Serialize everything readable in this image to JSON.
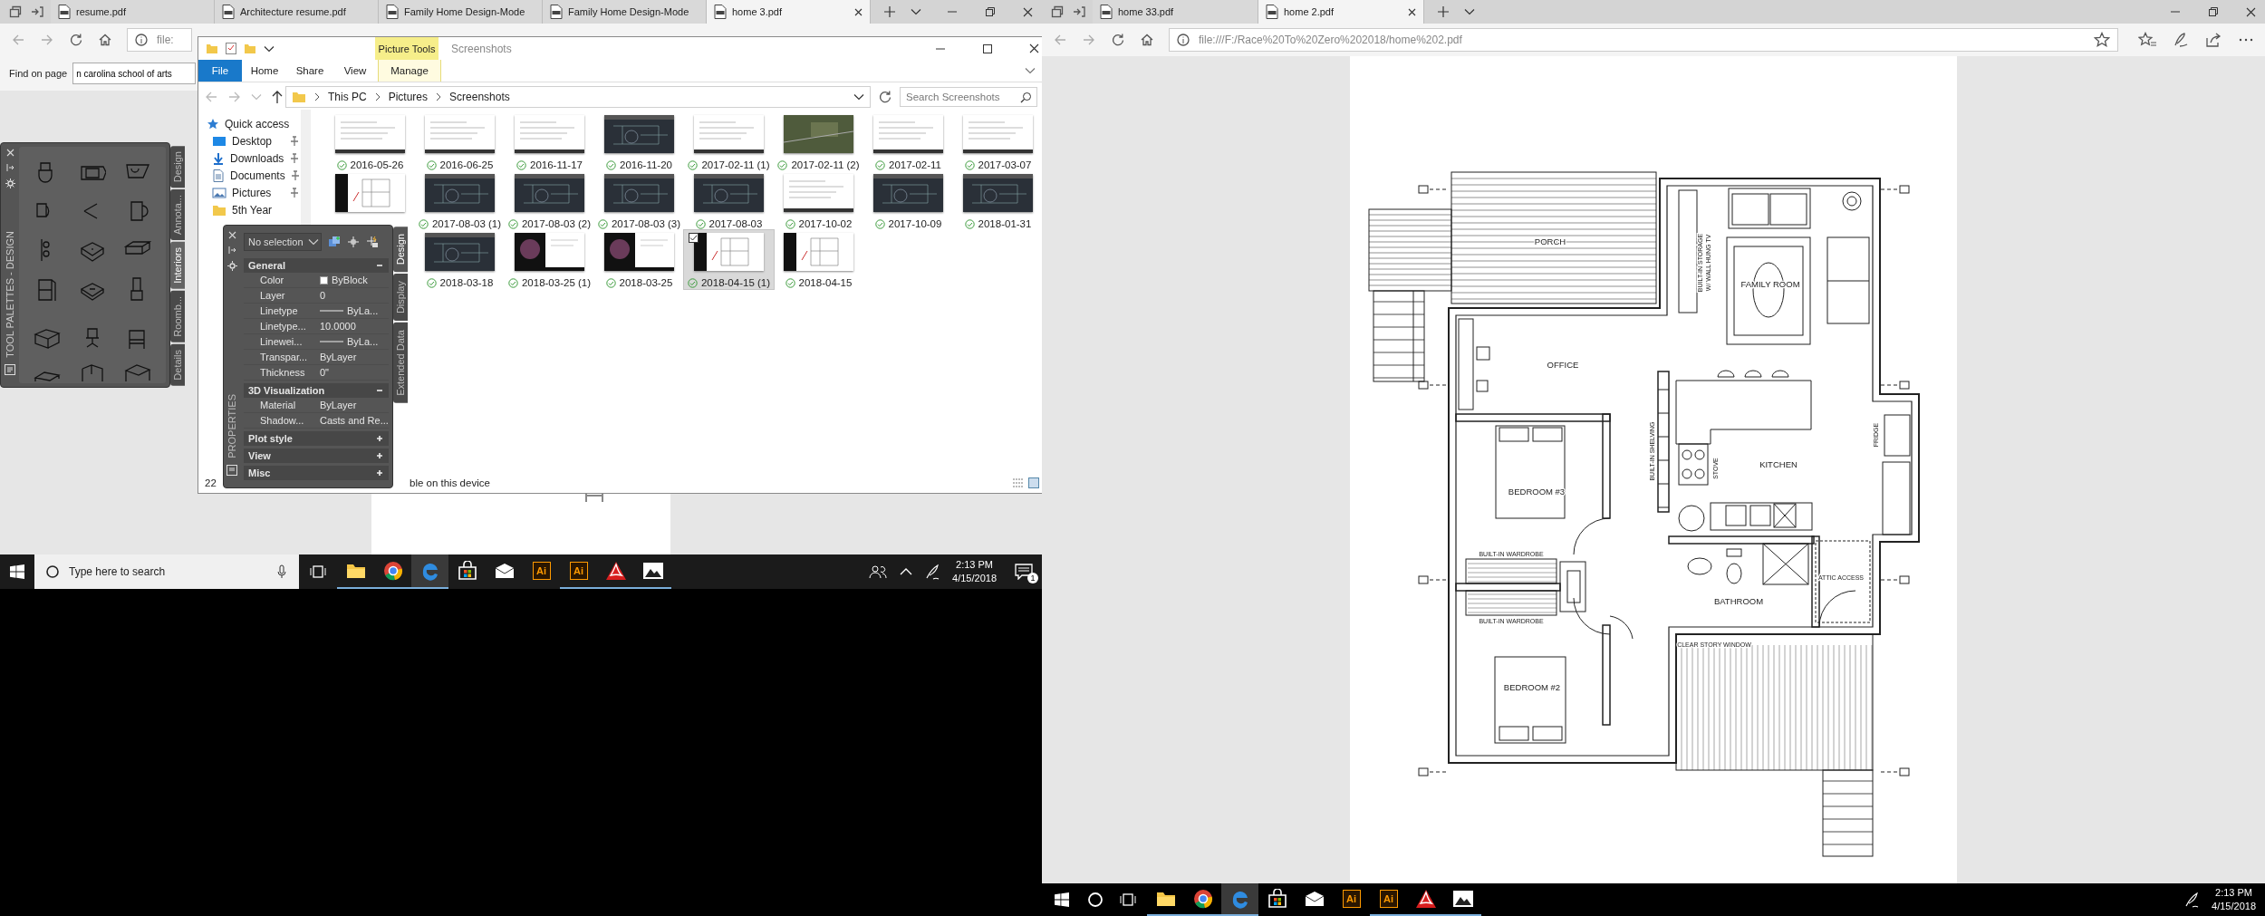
{
  "left_browser": {
    "tabs": [
      {
        "title": "resume.pdf",
        "selected": false
      },
      {
        "title": "Architecture resume.pdf",
        "selected": false
      },
      {
        "title": "Family Home Design-Mode",
        "selected": false
      },
      {
        "title": "Family Home Design-Mode",
        "selected": false
      },
      {
        "title": "home 3.pdf",
        "selected": true
      }
    ],
    "address": "file:",
    "find_bar": {
      "label": "Find on page",
      "value": "n carolina school of arts"
    }
  },
  "file_explorer": {
    "title": "Screenshots",
    "context_tab": "Picture Tools",
    "ribbon_tabs": [
      {
        "label": "File",
        "kind": "file",
        "selected": false
      },
      {
        "label": "Home",
        "kind": "tab",
        "selected": false
      },
      {
        "label": "Share",
        "kind": "tab",
        "selected": false
      },
      {
        "label": "View",
        "kind": "tab",
        "selected": false
      },
      {
        "label": "Manage",
        "kind": "context",
        "selected": false
      }
    ],
    "breadcrumb": [
      "This PC",
      "Pictures",
      "Screenshots"
    ],
    "search": {
      "placeholder": "Search Screenshots"
    },
    "nav_items": [
      {
        "label": "Quick access",
        "kind": "star",
        "pinned": false
      },
      {
        "label": "Desktop",
        "kind": "desktop",
        "pinned": true
      },
      {
        "label": "Downloads",
        "kind": "download",
        "pinned": true
      },
      {
        "label": "Documents",
        "kind": "document",
        "pinned": true
      },
      {
        "label": "Pictures",
        "kind": "picture",
        "pinned": true
      },
      {
        "label": "5th Year",
        "kind": "folder",
        "pinned": false
      }
    ],
    "files": [
      {
        "name": "2016-05-26",
        "kind": "light",
        "selected": false
      },
      {
        "name": "2016-06-25",
        "kind": "light",
        "selected": false
      },
      {
        "name": "2016-11-17",
        "kind": "light",
        "selected": false
      },
      {
        "name": "2016-11-20",
        "kind": "dark",
        "selected": false
      },
      {
        "name": "2017-02-11 (1)",
        "kind": "light",
        "selected": false
      },
      {
        "name": "2017-02-11 (2)",
        "kind": "aerial",
        "selected": false
      },
      {
        "name": "2017-02-11",
        "kind": "light",
        "selected": false
      },
      {
        "name": "2017-03-07",
        "kind": "light",
        "selected": false
      },
      {
        "kind": "plan",
        "selected": false
      },
      {
        "name": "2017-08-03 (1)",
        "kind": "dark",
        "selected": false
      },
      {
        "name": "2017-08-03 (2)",
        "kind": "dark",
        "selected": false
      },
      {
        "name": "2017-08-03 (3)",
        "kind": "dark",
        "selected": false
      },
      {
        "name": "2017-08-03",
        "kind": "dark",
        "selected": false
      },
      {
        "name": "2017-10-02",
        "kind": "light",
        "selected": false
      },
      {
        "name": "2017-10-09",
        "kind": "dark",
        "selected": false
      },
      {
        "name": "2018-01-31",
        "kind": "dark",
        "selected": false
      },
      {
        "kind": "covered"
      },
      {
        "name": "2018-03-18",
        "kind": "dark",
        "selected": false
      },
      {
        "name": "2018-03-25 (1)",
        "kind": "photo",
        "selected": false
      },
      {
        "name": "2018-03-25",
        "kind": "photo",
        "selected": false
      },
      {
        "name": "2018-04-15 (1)",
        "kind": "plan",
        "selected": true
      },
      {
        "name": "2018-04-15",
        "kind": "plan",
        "selected": false
      }
    ],
    "status": [
      "22",
      "ble on this device"
    ]
  },
  "tool_palette": {
    "title": "TOOL PALETTES - DESIGN",
    "tabs": [
      {
        "label": "Design",
        "selected": false
      },
      {
        "label": "Annota...",
        "selected": false
      },
      {
        "label": "Interiors",
        "selected": true
      },
      {
        "label": "Roomb...",
        "selected": false
      },
      {
        "label": "Details",
        "selected": false
      }
    ]
  },
  "properties": {
    "title": "PROPERTIES",
    "selection": "No selection",
    "sections": [
      {
        "title": "General",
        "expanded": true,
        "rows": [
          {
            "label": "Color",
            "value": "ByBlock",
            "kind": "swatch"
          },
          {
            "label": "Layer",
            "value": "0",
            "kind": "text"
          },
          {
            "label": "Linetype",
            "value": "ByLa...",
            "kind": "line"
          },
          {
            "label": "Linetype...",
            "value": "10.0000",
            "kind": "text"
          },
          {
            "label": "Linewei...",
            "value": "ByLa...",
            "kind": "line"
          },
          {
            "label": "Transpar...",
            "value": "ByLayer",
            "kind": "text"
          },
          {
            "label": "Thickness",
            "value": "0\"",
            "kind": "text"
          }
        ]
      },
      {
        "title": "3D Visualization",
        "expanded": true,
        "rows": [
          {
            "label": "Material",
            "value": "ByLayer",
            "kind": "text"
          },
          {
            "label": "Shadow...",
            "value": "Casts and Re...",
            "kind": "text"
          }
        ]
      },
      {
        "title": "Plot style",
        "expanded": false
      },
      {
        "title": "View",
        "expanded": false
      },
      {
        "title": "Misc",
        "expanded": false
      }
    ],
    "tabs": [
      {
        "label": "Design",
        "selected": true
      },
      {
        "label": "Display",
        "selected": false
      },
      {
        "label": "Extended Data",
        "selected": false
      }
    ]
  },
  "left_taskbar": {
    "search": {
      "placeholder": "Type here to search"
    },
    "apps": [
      {
        "kind": "folder",
        "running": true,
        "active": false
      },
      {
        "kind": "chrome",
        "running": true,
        "active": false
      },
      {
        "kind": "edge",
        "running": true,
        "active": true
      },
      {
        "kind": "store",
        "running": false,
        "active": false
      },
      {
        "kind": "mail",
        "running": false,
        "active": false
      },
      {
        "kind": "illustrator",
        "label": "Ai",
        "running": false,
        "active": false
      },
      {
        "kind": "illustrator",
        "label": "Ai",
        "running": true,
        "active": false
      },
      {
        "kind": "acrobat",
        "running": true,
        "active": false
      },
      {
        "kind": "photos",
        "running": true,
        "active": false
      }
    ],
    "time": "2:13 PM",
    "date": "4/15/2018",
    "notification_count": "1"
  },
  "right_browser": {
    "tabs": [
      {
        "title": "home 33.pdf",
        "selected": false
      },
      {
        "title": "home 2.pdf",
        "selected": true
      }
    ],
    "address": "file:///F:/Race%20To%20Zero%202018/home%202.pdf",
    "plan_labels": [
      {
        "text": "PORCH",
        "kind": "room"
      },
      {
        "text": "FAMILY ROOM",
        "kind": "room"
      },
      {
        "text": "BUILT-IN STORAGE",
        "kind": "vertical_note"
      },
      {
        "text": "W/ WALL HUNG TV",
        "kind": "vertical_note"
      },
      {
        "text": "OFFICE",
        "kind": "room"
      },
      {
        "text": "BUILT-IN SHELVING",
        "kind": "vertical_note"
      },
      {
        "text": "STOVE",
        "kind": "vertical_note"
      },
      {
        "text": "KITCHEN",
        "kind": "room"
      },
      {
        "text": "FRIDGE",
        "kind": "vertical_note"
      },
      {
        "text": "BEDROOM #3",
        "kind": "room"
      },
      {
        "text": "BUILT-IN WARDROBE",
        "kind": "note"
      },
      {
        "text": "ATTIC ACCESS",
        "kind": "note"
      },
      {
        "text": "BATHROOM",
        "kind": "room"
      },
      {
        "text": "BUILT-IN WARDROBE",
        "kind": "note"
      },
      {
        "text": "CLEAR STORY WINDOW",
        "kind": "note"
      },
      {
        "text": "BEDROOM #2",
        "kind": "room"
      }
    ]
  },
  "right_taskbar": {
    "apps": [
      {
        "kind": "folder",
        "running": true,
        "active": false
      },
      {
        "kind": "chrome",
        "running": true,
        "active": false
      },
      {
        "kind": "edge",
        "running": true,
        "active": true
      },
      {
        "kind": "store",
        "running": false,
        "active": false
      },
      {
        "kind": "mail",
        "running": false,
        "active": false
      },
      {
        "kind": "illustrator",
        "label": "Ai",
        "running": false,
        "active": false
      },
      {
        "kind": "illustrator",
        "label": "Ai",
        "running": true,
        "active": false
      },
      {
        "kind": "acrobat",
        "running": true,
        "active": false
      },
      {
        "kind": "photos",
        "running": true,
        "active": false
      }
    ],
    "time": "2:13 PM",
    "date": "4/15/2018"
  }
}
